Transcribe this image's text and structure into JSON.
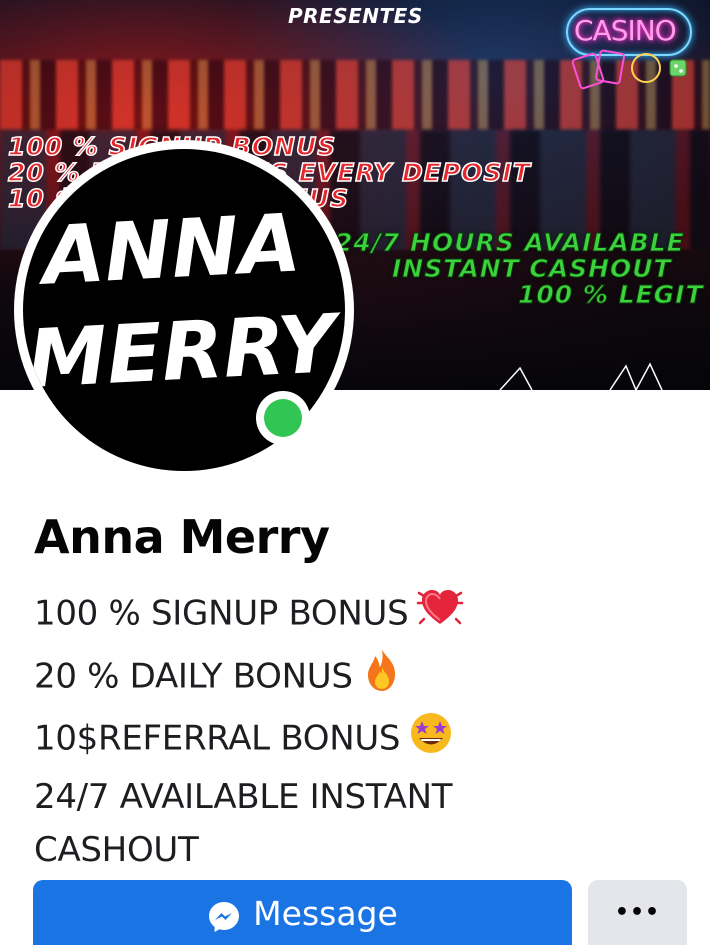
{
  "cover": {
    "presentes": "PRESENTES",
    "casino": "CASINO",
    "promo_red": [
      "100 % SIGNUP BONUS",
      "20 % DAILY BONUS EVERY DEPOSIT",
      "10 $ REFERRAL BONUS"
    ],
    "promo_green": [
      "24/7 HOURS AVAILABLE",
      "INSTANT CASHOUT",
      "100 % LEGIT"
    ]
  },
  "avatar": {
    "logo_line1": "ANNA",
    "logo_line2": "MERRY",
    "online": true
  },
  "profile": {
    "name": "Anna Merry",
    "bio": [
      {
        "text": "100 % SIGNUP BONUS",
        "emoji": "sparkling-heart"
      },
      {
        "text": "20 % DAILY BONUS",
        "emoji": "fire"
      },
      {
        "text": "10$REFERRAL BONUS",
        "emoji": "star-struck"
      },
      {
        "text": "24/7 AVAILABLE INSTANT",
        "emoji": ""
      },
      {
        "text": "CASHOUT",
        "emoji": ""
      }
    ]
  },
  "actions": {
    "message_label": "Message",
    "message_icon": "messenger-icon",
    "more_label": "•••"
  },
  "colors": {
    "primary_button": "#1b74e4",
    "secondary_button": "#e4e6eb",
    "online": "#31c653"
  }
}
